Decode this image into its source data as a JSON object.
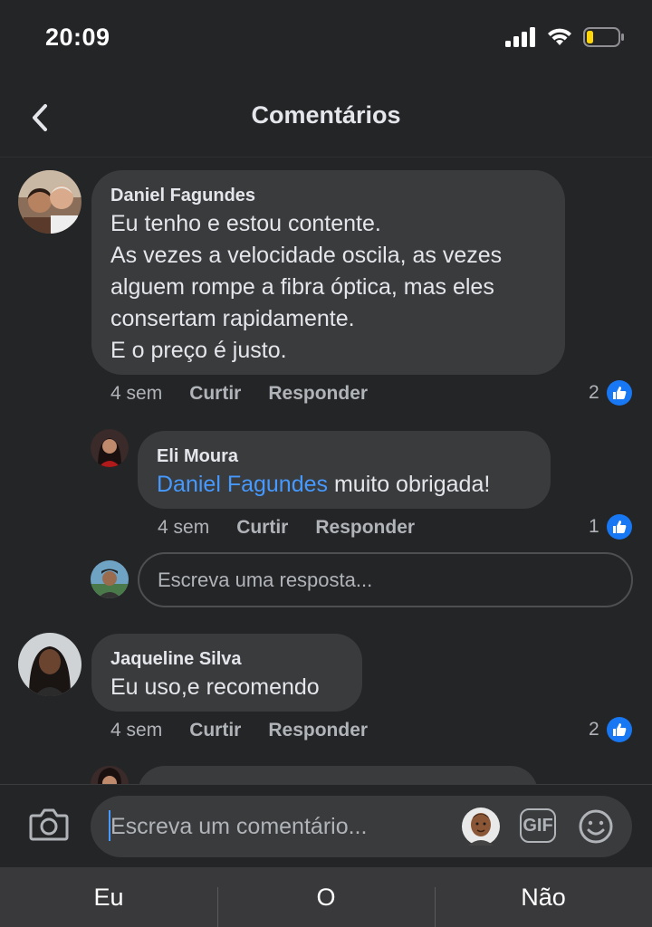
{
  "status_bar": {
    "time": "20:09",
    "battery_color": "#ffd60a"
  },
  "header": {
    "title": "Comentários",
    "back_icon": "chevron-left-icon"
  },
  "comments": [
    {
      "author": "Daniel Fagundes",
      "text": "Eu tenho e estou contente.\nAs vezes a velocidade oscila, as vezes alguem rompe a fibra óptica, mas eles consertam rapidamente.\nE o preço é  justo.",
      "time": "4 sem",
      "like_label": "Curtir",
      "reply_label": "Responder",
      "likes": "2",
      "replies": [
        {
          "author": "Eli Moura",
          "mention": "Daniel Fagundes",
          "text": " muito obrigada!",
          "time": "4 sem",
          "like_label": "Curtir",
          "reply_label": "Responder",
          "likes": "1"
        }
      ]
    },
    {
      "author": "Jaqueline Silva",
      "text": "Eu uso,e recomendo",
      "time": "4 sem",
      "like_label": "Curtir",
      "reply_label": "Responder",
      "likes": "2"
    }
  ],
  "reply_input": {
    "placeholder": "Escreva uma resposta..."
  },
  "composer": {
    "placeholder": "Escreva um comentário...",
    "gif_label": "GIF",
    "icons": [
      "camera-icon",
      "memoji-icon",
      "gif-icon",
      "smiley-icon"
    ]
  },
  "keyboard_suggestions": [
    "Eu",
    "O",
    "Não"
  ],
  "colors": {
    "background": "#242526",
    "bubble": "#3a3b3c",
    "accent": "#1877f2",
    "mention": "#4599ff",
    "secondary_text": "#b0b3b8"
  }
}
